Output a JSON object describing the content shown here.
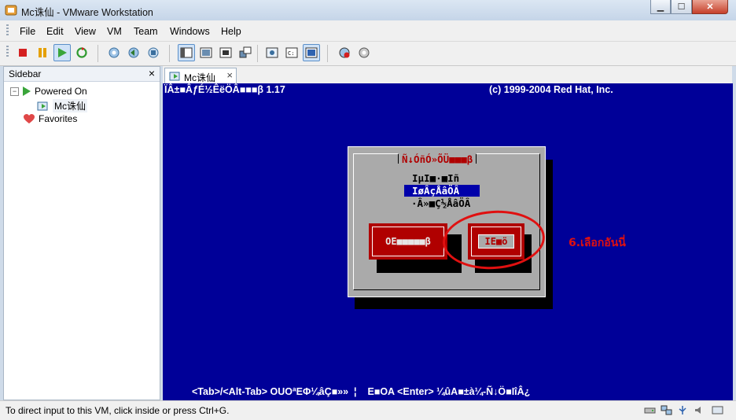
{
  "window": {
    "title": "Mc诛仙 - VMware Workstation"
  },
  "menu": [
    "File",
    "Edit",
    "View",
    "VM",
    "Team",
    "Windows",
    "Help"
  ],
  "sidebar": {
    "title": "Sidebar",
    "close": "×",
    "tree": {
      "group": "Powered On",
      "vm": "Mc诛仙",
      "favorites": "Favorites"
    }
  },
  "tab": {
    "label": "Mc诛仙",
    "close": "×"
  },
  "console": {
    "header_left": "ÏÂ±■ÂƒÉ½ÊëÖÂ■■■β 1.17",
    "header_right": "(c) 1999-2004 Red Hat, Inc.",
    "dialog_title": "Ñ↓ÓñÓ»ÕÜ■■■β",
    "options": [
      "IµI■·■Iñ",
      "IøÂçÅâÖÂ",
      "·Â»■Ç½ÅâÖÂ"
    ],
    "selected_index": 1,
    "button_left": "OE■■■■■β",
    "button_right": "IE■ö",
    "footer": "<Tab>/<Alt-Tab> OUOªEΦ¼âÇ■»»  ¦    E■OA <Enter> ¼ûA■±à¼-Ñ↓Ö■IîÂ¿"
  },
  "annotation": {
    "text": "6.เลือกอันนี่",
    "color": "#e01010"
  },
  "status": {
    "text": "To direct input to this VM, click inside or press Ctrl+G."
  },
  "colors": {
    "console_bg": "#000098",
    "dialog_bg": "#aaaaaa",
    "button_red": "#b00000"
  },
  "toolbar_icons": [
    "stop-icon",
    "pause-icon",
    "play-icon",
    "reset-icon",
    "snapshot-icon",
    "revert-snapshot-icon",
    "snapshot-manager-icon",
    "sidebar-view-icon",
    "quick-switch-icon",
    "fullscreen-icon",
    "unity-icon",
    "summary-icon",
    "console-view-icon",
    "show-console-icon",
    "capture-icon",
    "settings-icon"
  ]
}
